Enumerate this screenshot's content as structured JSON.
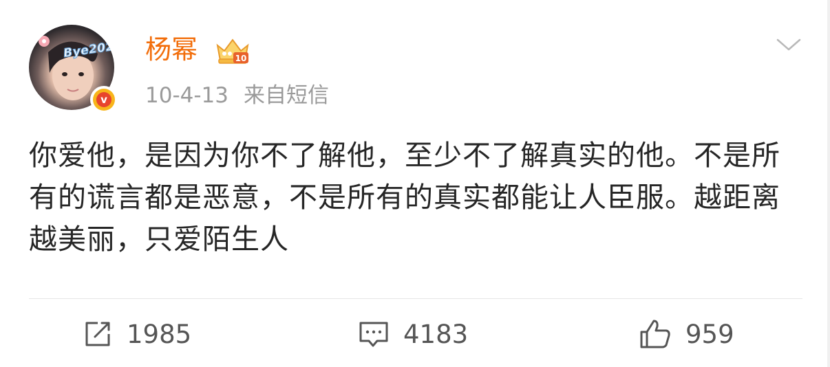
{
  "post": {
    "author": {
      "name": "杨幂",
      "avatar_caption": "Bye2020",
      "verified_mark": "v",
      "vip_level": "10"
    },
    "meta": {
      "date": "10-4-13",
      "source": "来自短信"
    },
    "text": "你爱他，是因为你不了解他，至少不了解真实的他。不是所有的谎言都是恶意，不是所有的真实都能让人臣服。越距离越美丽，只爱陌生人",
    "actions": {
      "repost_count": "1985",
      "comment_count": "4183",
      "like_count": "959"
    },
    "icons": {
      "more": "chevron-down-icon",
      "repost": "repost-icon",
      "comment": "comment-icon",
      "like": "thumbs-up-icon"
    },
    "colors": {
      "username": "#f26d0a",
      "meta": "#9a9a9a",
      "text": "#262626",
      "verified": "#e8442d",
      "badge_gold": "#f8b51b"
    }
  }
}
